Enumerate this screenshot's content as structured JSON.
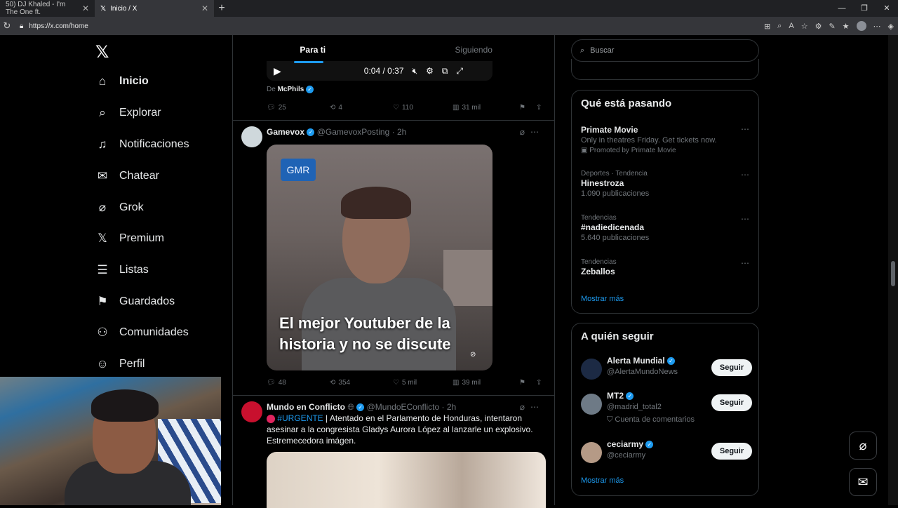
{
  "browser": {
    "tabs": [
      {
        "title": "50) DJ Khaled - I'm The One ft."
      },
      {
        "title": "Inicio / X"
      }
    ],
    "url": "https://x.com/home"
  },
  "nav": {
    "items": [
      {
        "label": "Inicio",
        "icon": "home-icon"
      },
      {
        "label": "Explorar",
        "icon": "search-icon"
      },
      {
        "label": "Notificaciones",
        "icon": "bell-icon"
      },
      {
        "label": "Chatear",
        "icon": "mail-icon"
      },
      {
        "label": "Grok",
        "icon": "grok-icon"
      },
      {
        "label": "Premium",
        "icon": "x-icon"
      },
      {
        "label": "Listas",
        "icon": "list-icon"
      },
      {
        "label": "Guardados",
        "icon": "bookmark-icon"
      },
      {
        "label": "Comunidades",
        "icon": "people-icon"
      },
      {
        "label": "Perfil",
        "icon": "person-icon"
      }
    ]
  },
  "feed": {
    "tabs": [
      "Para ti",
      "Siguiendo"
    ],
    "post1": {
      "video_time": "0:04 / 0:37",
      "source_prefix": "De",
      "source_name": "McPhils",
      "replies": "25",
      "reposts": "4",
      "likes": "110",
      "views": "31 mil"
    },
    "post2": {
      "name": "Gamevox",
      "handle": "@GamevoxPosting",
      "time": "· 2h",
      "badge": "GMR",
      "overlay": "El mejor Youtuber de la historia y no se discute",
      "replies": "48",
      "reposts": "354",
      "likes": "5 mil",
      "views": "39 mil"
    },
    "post3": {
      "name": "Mundo en Conflicto",
      "handle": "@MundoEConflicto",
      "time": "· 2h",
      "hashtag": "#URGENTE",
      "text": "| Atentado en el Parlamento de Honduras, intentaron asesinar a la congresista Gladys Aurora López al lanzarle un explosivo. Estremecedora imágen."
    }
  },
  "sidebar": {
    "search_placeholder": "Buscar",
    "trending_title": "Qué está pasando",
    "trends": [
      {
        "meta": "",
        "name": "Primate Movie",
        "sub": "Only in theatres Friday. Get tickets now.",
        "promo": "Promoted by Primate Movie"
      },
      {
        "meta": "Deportes · Tendencia",
        "name": "Hinestroza",
        "sub": "1.090 publicaciones"
      },
      {
        "meta": "Tendencias",
        "name": "#nadiedicenada",
        "sub": "5.640 publicaciones"
      },
      {
        "meta": "Tendencias",
        "name": "Zeballos",
        "sub": ""
      }
    ],
    "show_more": "Mostrar más",
    "follow_title": "A quién seguir",
    "follow": [
      {
        "name": "Alerta Mundial",
        "handle": "@AlertaMundoNews",
        "extra": "",
        "button": "Seguir"
      },
      {
        "name": "MT2",
        "handle": "@madrid_total2",
        "extra": "Cuenta de comentarios",
        "button": "Seguir"
      },
      {
        "name": "ceciarmy",
        "handle": "@ceciarmy",
        "extra": "",
        "button": "Seguir"
      }
    ],
    "show_more2": "Mostrar más"
  },
  "colors": {
    "accent": "#1d9bf0",
    "background": "#000000",
    "border": "#2f3336"
  }
}
